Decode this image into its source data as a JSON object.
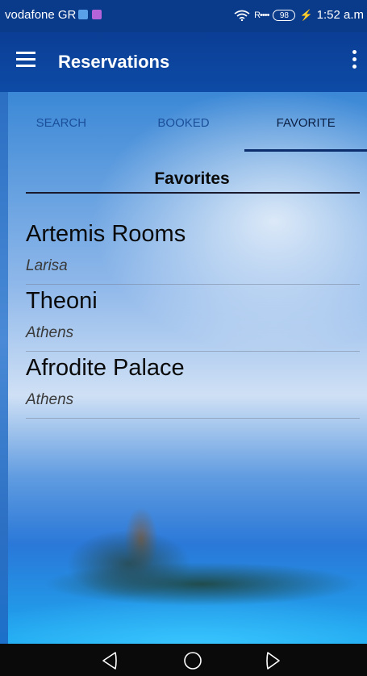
{
  "status_bar": {
    "carrier": "vodafone GR",
    "signal": "R",
    "battery": "98",
    "time": "1:52 a.m"
  },
  "app_bar": {
    "title": "Reservations"
  },
  "tabs": [
    {
      "label": "SEARCH",
      "active": false
    },
    {
      "label": "BOOKED",
      "active": false
    },
    {
      "label": "FAVORITE",
      "active": true
    }
  ],
  "favorites": {
    "title": "Favorites",
    "items": [
      {
        "name": "Artemis Rooms",
        "city": "Larisa"
      },
      {
        "name": "Theoni",
        "city": "Athens"
      },
      {
        "name": "Afrodite Palace",
        "city": "Athens"
      }
    ]
  },
  "colors": {
    "app_bar": "#0b3e95",
    "tab_text": "#1b4f9a",
    "tab_active_text": "#0b1f44",
    "nav_bar": "#0a0a0a"
  },
  "icons": {
    "menu": "hamburger-menu-icon",
    "overflow": "more-vert-icon",
    "back": "back-icon",
    "home": "home-icon",
    "recent": "recent-apps-icon"
  }
}
